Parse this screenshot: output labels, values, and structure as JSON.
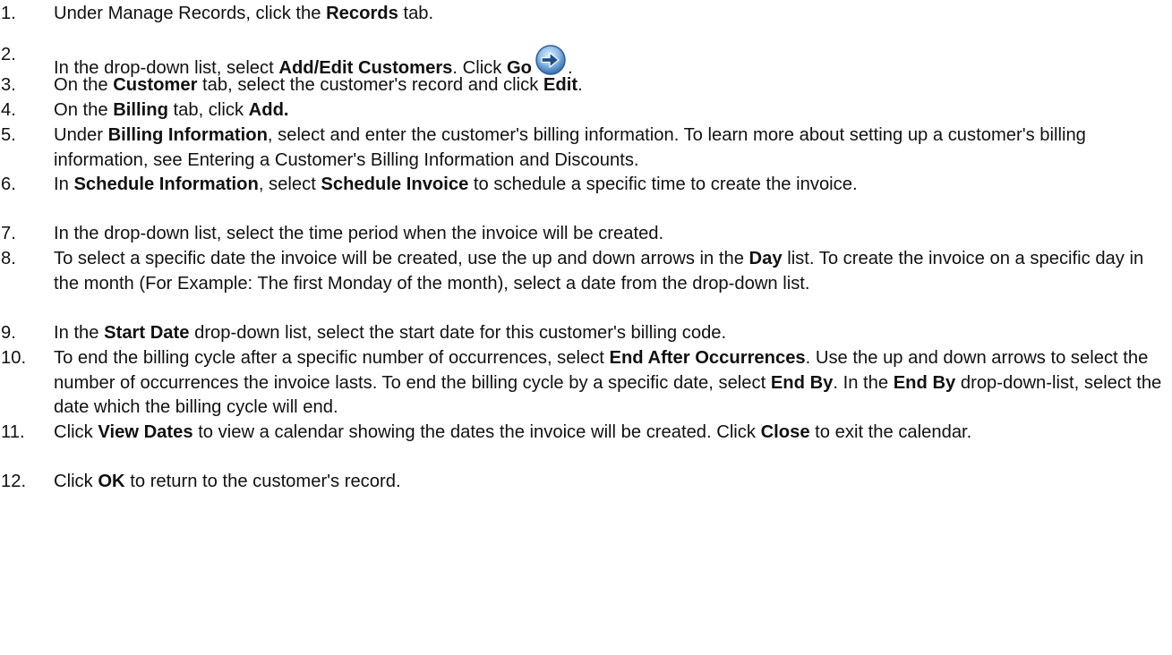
{
  "steps": [
    {
      "number": "1.",
      "parts": [
        {
          "t": "Under Manage Records, click the "
        },
        {
          "b": "Records"
        },
        {
          "t": " tab."
        }
      ]
    },
    {
      "number": "2.",
      "parts": [
        {
          "t": "In the drop-down list, select "
        },
        {
          "b": "Add/Edit Customers"
        },
        {
          "t": ". Click "
        },
        {
          "b": "Go"
        },
        {
          "icon": "go-arrow-icon"
        },
        {
          "t": "."
        }
      ]
    },
    {
      "number": "3.",
      "parts": [
        {
          "t": "On the "
        },
        {
          "b": "Customer"
        },
        {
          "t": " tab, select the customer's record and click "
        },
        {
          "b": "Edit"
        },
        {
          "t": "."
        }
      ]
    },
    {
      "number": "4.",
      "parts": [
        {
          "t": "On the "
        },
        {
          "b": "Billing"
        },
        {
          "t": " tab, click "
        },
        {
          "b": "Add."
        }
      ]
    },
    {
      "number": "5.",
      "parts": [
        {
          "t": "Under "
        },
        {
          "b": "Billing Information"
        },
        {
          "t": ", select and enter the customer's billing information. To learn more about setting up a customer's billing information, see Entering a Customer's Billing Information and Discounts."
        }
      ]
    },
    {
      "number": "6.",
      "parts": [
        {
          "t": "In "
        },
        {
          "b": "Schedule Information"
        },
        {
          "t": ", select "
        },
        {
          "b": "Schedule Invoice"
        },
        {
          "t": " to schedule a specific time to create the invoice."
        }
      ]
    },
    {
      "number": "7.",
      "parts": [
        {
          "t": "In the drop-down list, select the time period when the invoice will be created."
        }
      ]
    },
    {
      "number": "8.",
      "parts": [
        {
          "t": "To select a specific date the invoice will be created, use the up and down arrows in the "
        },
        {
          "b": "Day"
        },
        {
          "t": " list. To create the invoice on a specific day in the month (For Example: The first Monday of the month), select a date from the drop-down list."
        }
      ]
    },
    {
      "number": "9.",
      "parts": [
        {
          "t": "In the "
        },
        {
          "b": "Start Date"
        },
        {
          "t": " drop-down list, select the start date for this customer's billing code."
        }
      ]
    },
    {
      "number": "10.",
      "parts": [
        {
          "t": "To end the billing cycle after a specific number of occurrences, select "
        },
        {
          "b": "End After Occurrences"
        },
        {
          "t": ". Use the up and down arrows to select the number of occurrences the invoice lasts. To end the billing cycle by a specific date, select "
        },
        {
          "b": "End By"
        },
        {
          "t": ". In the "
        },
        {
          "b": "End By"
        },
        {
          "t": " drop-down-list, select the date which the billing cycle will end."
        }
      ]
    },
    {
      "number": "11.",
      "parts": [
        {
          "t": "Click "
        },
        {
          "b": "View Dates"
        },
        {
          "t": " to view a calendar showing the dates the invoice will be created. Click "
        },
        {
          "b": "Close"
        },
        {
          "t": " to exit the calendar."
        }
      ]
    },
    {
      "number": "12.",
      "parts": [
        {
          "t": "Click "
        },
        {
          "b": "OK"
        },
        {
          "t": " to return to the customer's record."
        }
      ]
    }
  ]
}
